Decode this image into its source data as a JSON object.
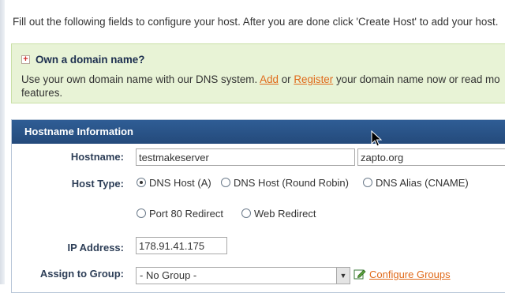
{
  "intro_text": "Fill out the following fields to configure your host. After you are done click 'Create Host' to add your host.",
  "domain_box": {
    "heading": "Own a domain name?",
    "desc_prefix": "Use your own domain name with our DNS system. ",
    "add_link": "Add",
    "or_text": " or ",
    "register_link": "Register",
    "desc_suffix": " your domain name now or read mo",
    "desc_line2": "features."
  },
  "panel": {
    "title": "Hostname Information",
    "hostname": {
      "label": "Hostname:",
      "value": "testmakeserver",
      "domain": "zapto.org"
    },
    "host_type": {
      "label": "Host Type:",
      "options": [
        {
          "label": "DNS Host (A)",
          "selected": true
        },
        {
          "label": "DNS Host (Round Robin)",
          "selected": false
        },
        {
          "label": "DNS Alias (CNAME)",
          "selected": false
        },
        {
          "label": "Port 80 Redirect",
          "selected": false
        },
        {
          "label": "Web Redirect",
          "selected": false
        }
      ]
    },
    "ip_address": {
      "label": "IP Address:",
      "value": "178.91.41.175"
    },
    "group": {
      "label": "Assign to Group:",
      "value": "- No Group -",
      "link": "Configure Groups"
    }
  },
  "icons": {
    "expand": "plus-icon",
    "edit": "edit-icon",
    "dropdown": "chevron-down-icon",
    "pointer": "mouse-cursor-icon"
  },
  "colors": {
    "header_bg": "#2a5489",
    "link": "#e06a1a",
    "info_bg": "#e8f3d6"
  }
}
